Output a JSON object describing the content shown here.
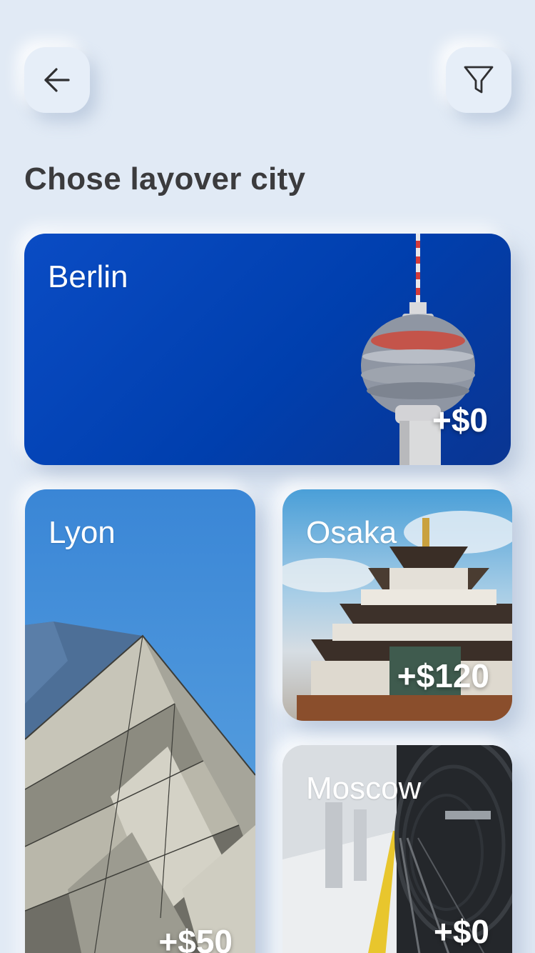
{
  "header": {
    "back_icon": "arrow-left-icon",
    "filter_icon": "filter-funnel-icon",
    "title": "Chose layover city"
  },
  "cities": {
    "berlin": {
      "name": "Berlin",
      "price": "+$0"
    },
    "lyon": {
      "name": "Lyon",
      "price": "+$50"
    },
    "osaka": {
      "name": "Osaka",
      "price": "+$120"
    },
    "moscow": {
      "name": "Moscow",
      "price": "+$0"
    }
  },
  "colors": {
    "background": "#e1eaf5",
    "title_text": "#3b3b3d",
    "berlin_blue": "#003fae",
    "card_text": "#ffffff"
  }
}
